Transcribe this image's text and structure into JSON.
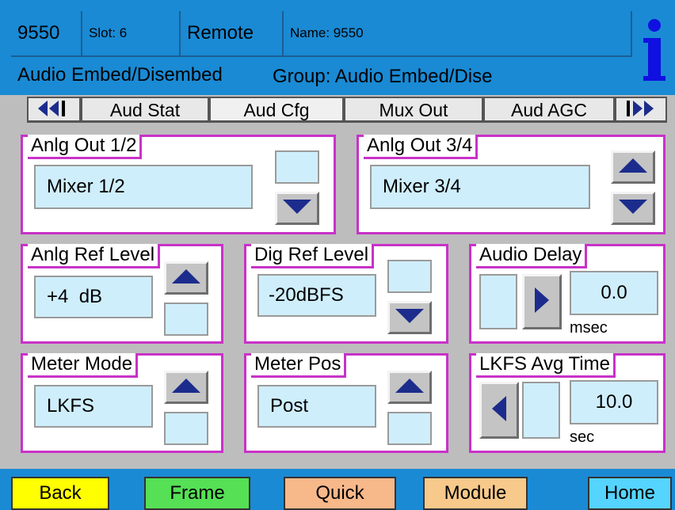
{
  "header": {
    "model": "9550",
    "slot": "Slot: 6",
    "mode": "Remote",
    "name": "Name: 9550",
    "description": "Audio Embed/Disembed",
    "group": "Group: Audio Embed/Dise",
    "info_icon": "info-icon"
  },
  "tabs": {
    "prev_icon": "double-left-arrow-icon",
    "items": [
      {
        "label": "Aud Stat"
      },
      {
        "label": "Aud Cfg"
      },
      {
        "label": "Mux Out"
      },
      {
        "label": "Aud AGC"
      }
    ],
    "next_icon": "double-right-arrow-icon"
  },
  "panels": {
    "anlg_out_12": {
      "title": "Anlg Out 1/2",
      "value": "Mixer 1/2"
    },
    "anlg_out_34": {
      "title": "Anlg Out 3/4",
      "value": "Mixer 3/4"
    },
    "anlg_ref_level": {
      "title": "Anlg Ref Level",
      "value": "+4  dB"
    },
    "dig_ref_level": {
      "title": "Dig Ref Level",
      "value": "-20dBFS"
    },
    "audio_delay": {
      "title": "Audio Delay",
      "value": "0.0",
      "unit": "msec"
    },
    "meter_mode": {
      "title": "Meter Mode",
      "value": "LKFS"
    },
    "meter_pos": {
      "title": "Meter Pos",
      "value": "Post"
    },
    "lkfs_avg_time": {
      "title": "LKFS Avg Time",
      "value": "10.0",
      "unit": "sec"
    }
  },
  "footer": {
    "back": "Back",
    "frame": "Frame",
    "quick": "Quick",
    "module": "Module",
    "home": "Home"
  },
  "colors": {
    "header_blue": "#1a8ad4",
    "panel_border": "#c832c8",
    "field_bg": "#cfeefc",
    "arrow_navy": "#1c2c8c",
    "back": "#ffff00",
    "frame": "#55e055",
    "quick": "#f7b88a",
    "module": "#f7c98a",
    "home": "#55d4ff"
  }
}
